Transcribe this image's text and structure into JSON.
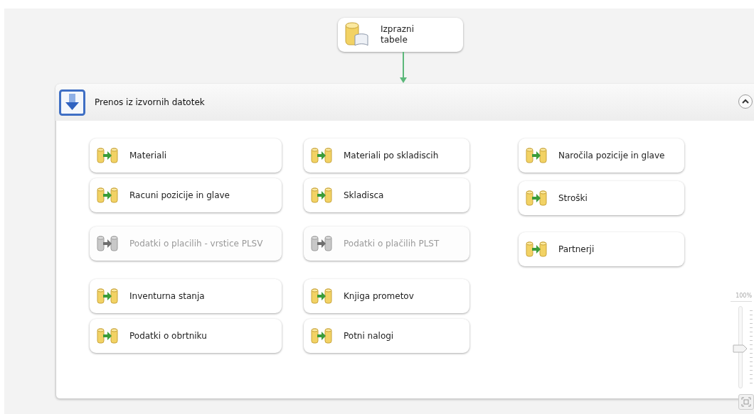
{
  "package_tasks": [
    {
      "label": "Izprazni\ntabele",
      "disabled": false,
      "kind": "sql"
    }
  ],
  "container": {
    "title": "Prenos iz izvornih datotek",
    "expanded": true,
    "tasks": [
      {
        "label": "Materiali",
        "disabled": false,
        "kind": "dataflow"
      },
      {
        "label": "Racuni pozicije in glave",
        "disabled": false,
        "kind": "dataflow"
      },
      {
        "label": "Podatki o placilih - vrstice PLSV",
        "disabled": true,
        "kind": "dataflow"
      },
      {
        "label": "Inventurna stanja",
        "disabled": false,
        "kind": "dataflow"
      },
      {
        "label": "Podatki o obrtniku",
        "disabled": false,
        "kind": "dataflow"
      },
      {
        "label": "Materiali po skladiscih",
        "disabled": false,
        "kind": "dataflow"
      },
      {
        "label": "Skladisca",
        "disabled": false,
        "kind": "dataflow"
      },
      {
        "label": "Podatki o plačilih PLST",
        "disabled": true,
        "kind": "dataflow"
      },
      {
        "label": "Knjiga prometov",
        "disabled": false,
        "kind": "dataflow"
      },
      {
        "label": "Potni nalogi",
        "disabled": false,
        "kind": "dataflow"
      },
      {
        "label": "Naročila pozicije in glave",
        "disabled": false,
        "kind": "dataflow"
      },
      {
        "label": "Stroški",
        "disabled": false,
        "kind": "dataflow"
      },
      {
        "label": "Partnerji",
        "disabled": false,
        "kind": "dataflow"
      }
    ]
  },
  "zoom": {
    "label": "100%",
    "level": 0.48
  }
}
